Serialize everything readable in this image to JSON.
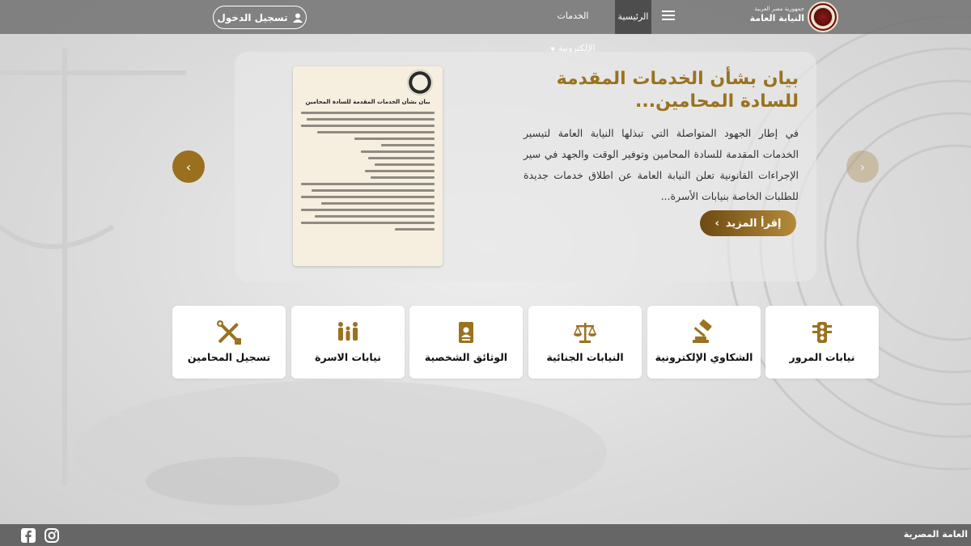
{
  "header": {
    "brand_small": "جمهورية مصر العربية",
    "brand_name": "النيابة العامة",
    "menu_icon": "hamburger-icon",
    "nav": {
      "home": "الرئيسية",
      "services": "الخدمات الإلكترونية"
    },
    "login_label": "تسجيل الدخول",
    "login_icon": "user-icon"
  },
  "hero": {
    "title": "بيان بشأن الخدمات المقدمة للسادة المحامين...",
    "text": "في إطار الجهود المتواصلة التي تبذلها النيابة العامة لتيسير الخدمات المقدمة للسادة المحامين وتوفير الوقت والجهد في سير الإجراءات القانونية تعلن النيابة العامة عن اطلاق خدمات جديدة للطلبات الخاصة بنيابات الأسرة...",
    "read_more": "إقرأ المزيد",
    "doc_title": "بيان بشأن الخدمات المقدمة للسادة المحامين"
  },
  "carousel": {
    "prev_icon": "chevron-left-icon",
    "next_icon": "chevron-right-icon"
  },
  "services": [
    {
      "label": "نيابات المرور",
      "icon": "traffic-light-icon"
    },
    {
      "label": "الشكاوي الإلكترونية",
      "icon": "gavel-icon"
    },
    {
      "label": "النيابات الجنائية",
      "icon": "scales-icon"
    },
    {
      "label": "الوثائق الشخصية",
      "icon": "id-card-icon"
    },
    {
      "label": "نيابات الاسرة",
      "icon": "family-icon"
    },
    {
      "label": "تسجيل المحامين",
      "icon": "tools-icon"
    }
  ],
  "footer": {
    "text": "العامة المصرية",
    "social": [
      "facebook-icon",
      "instagram-icon"
    ]
  },
  "colors": {
    "gold": "#9a7220",
    "header_bg": "#6e6e6e",
    "footer_bg": "#666666"
  }
}
